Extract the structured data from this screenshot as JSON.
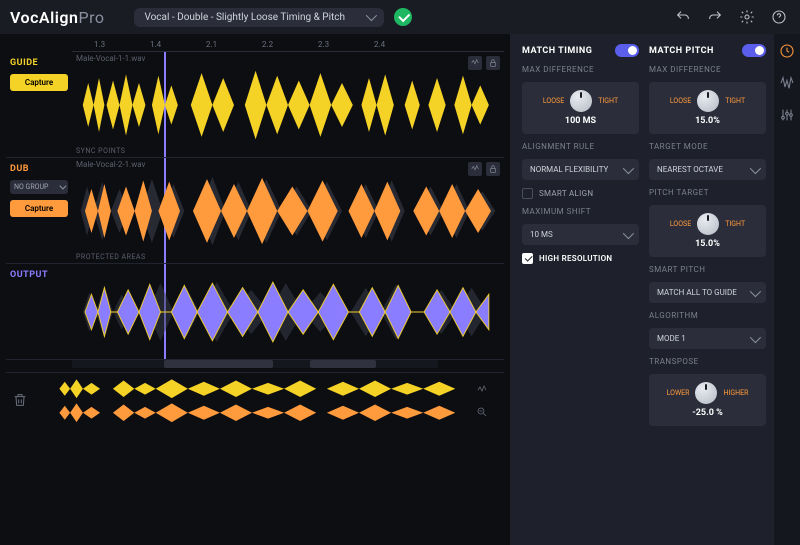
{
  "app": {
    "name": "VocAlign",
    "variant": "Pro"
  },
  "preset": {
    "name": "Vocal - Double - Slightly Loose Timing & Pitch"
  },
  "ruler": {
    "ticks": [
      "1.3",
      "1.4",
      "2.1",
      "2.2",
      "2.3",
      "2.4"
    ]
  },
  "tracks": {
    "guide": {
      "label": "GUIDE",
      "capture": "Capture",
      "filename": "Male-Vocal-1-1.wav",
      "sublabel": "SYNC POINTS"
    },
    "dub": {
      "label": "DUB",
      "capture": "Capture",
      "filename": "Male-Vocal-2-1.wav",
      "group": "NO GROUP",
      "sublabel": "PROTECTED AREAS"
    },
    "output": {
      "label": "OUTPUT"
    }
  },
  "timing": {
    "title": "MATCH TIMING",
    "on": true,
    "maxdiff": {
      "label": "MAX DIFFERENCE",
      "loose": "LOOSE",
      "tight": "TIGHT",
      "value": "100 MS"
    },
    "alignrule": {
      "label": "ALIGNMENT RULE",
      "value": "NORMAL FLEXIBILITY"
    },
    "smartalign": {
      "label": "SMART ALIGN",
      "checked": false
    },
    "maxshift": {
      "label": "MAXIMUM SHIFT",
      "value": "10 MS"
    },
    "highres": {
      "label": "HIGH RESOLUTION",
      "checked": true
    }
  },
  "pitch": {
    "title": "MATCH PITCH",
    "on": true,
    "maxdiff": {
      "label": "MAX DIFFERENCE",
      "loose": "LOOSE",
      "tight": "TIGHT",
      "value": "15.0%"
    },
    "targetmode": {
      "label": "TARGET MODE",
      "value": "NEAREST OCTAVE"
    },
    "pitchtarget": {
      "label": "PITCH TARGET",
      "loose": "LOOSE",
      "tight": "TIGHT",
      "value": "15.0%"
    },
    "smartpitch": {
      "label": "SMART PITCH",
      "value": "MATCH ALL TO GUIDE"
    },
    "algorithm": {
      "label": "ALGORITHM",
      "value": "MODE 1"
    },
    "transpose": {
      "label": "TRANSPOSE",
      "lower": "LOWER",
      "higher": "HIGHER",
      "value": "-25.0 %"
    }
  },
  "colors": {
    "guide": "#f5d226",
    "dub": "#ff9a3d",
    "output": "#8b7dff",
    "ghost": "#3a3d4a"
  }
}
